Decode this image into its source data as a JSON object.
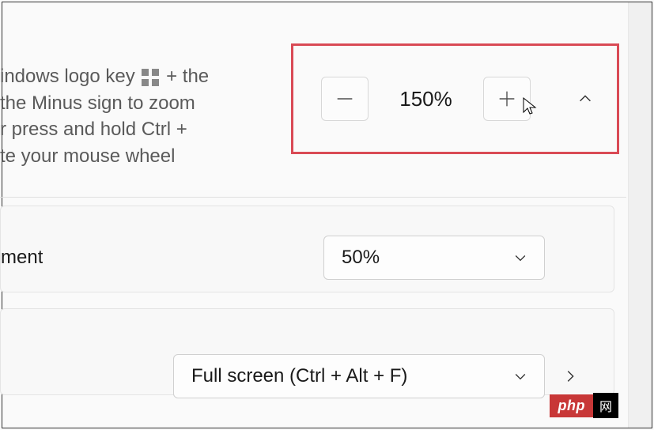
{
  "zoom": {
    "description_line1": "indows logo key",
    "description_line1_suffix": "+ the",
    "description_line2": " the Minus sign to zoom",
    "description_line3": "r press and hold Ctrl +",
    "description_line4": "te your mouse wheel",
    "value": "150%",
    "minus_label": "Zoom out",
    "plus_label": "Zoom in"
  },
  "increment": {
    "label": "ment",
    "value": "50%"
  },
  "fullscreen": {
    "value": "Full screen (Ctrl + Alt + F)"
  },
  "watermark": {
    "badge": "php",
    "suffix": "网"
  },
  "icons": {
    "minus": "minus-icon",
    "plus": "plus-icon",
    "chevron_up": "chevron-up-icon",
    "chevron_down": "chevron-down-icon",
    "chevron_right": "chevron-right-icon",
    "windows": "windows-logo-icon",
    "cursor": "cursor-icon"
  },
  "colors": {
    "highlight_border": "#d94a55",
    "text_muted": "#5a5a5a",
    "text": "#1a1a1a",
    "border": "#d0d0d0"
  }
}
